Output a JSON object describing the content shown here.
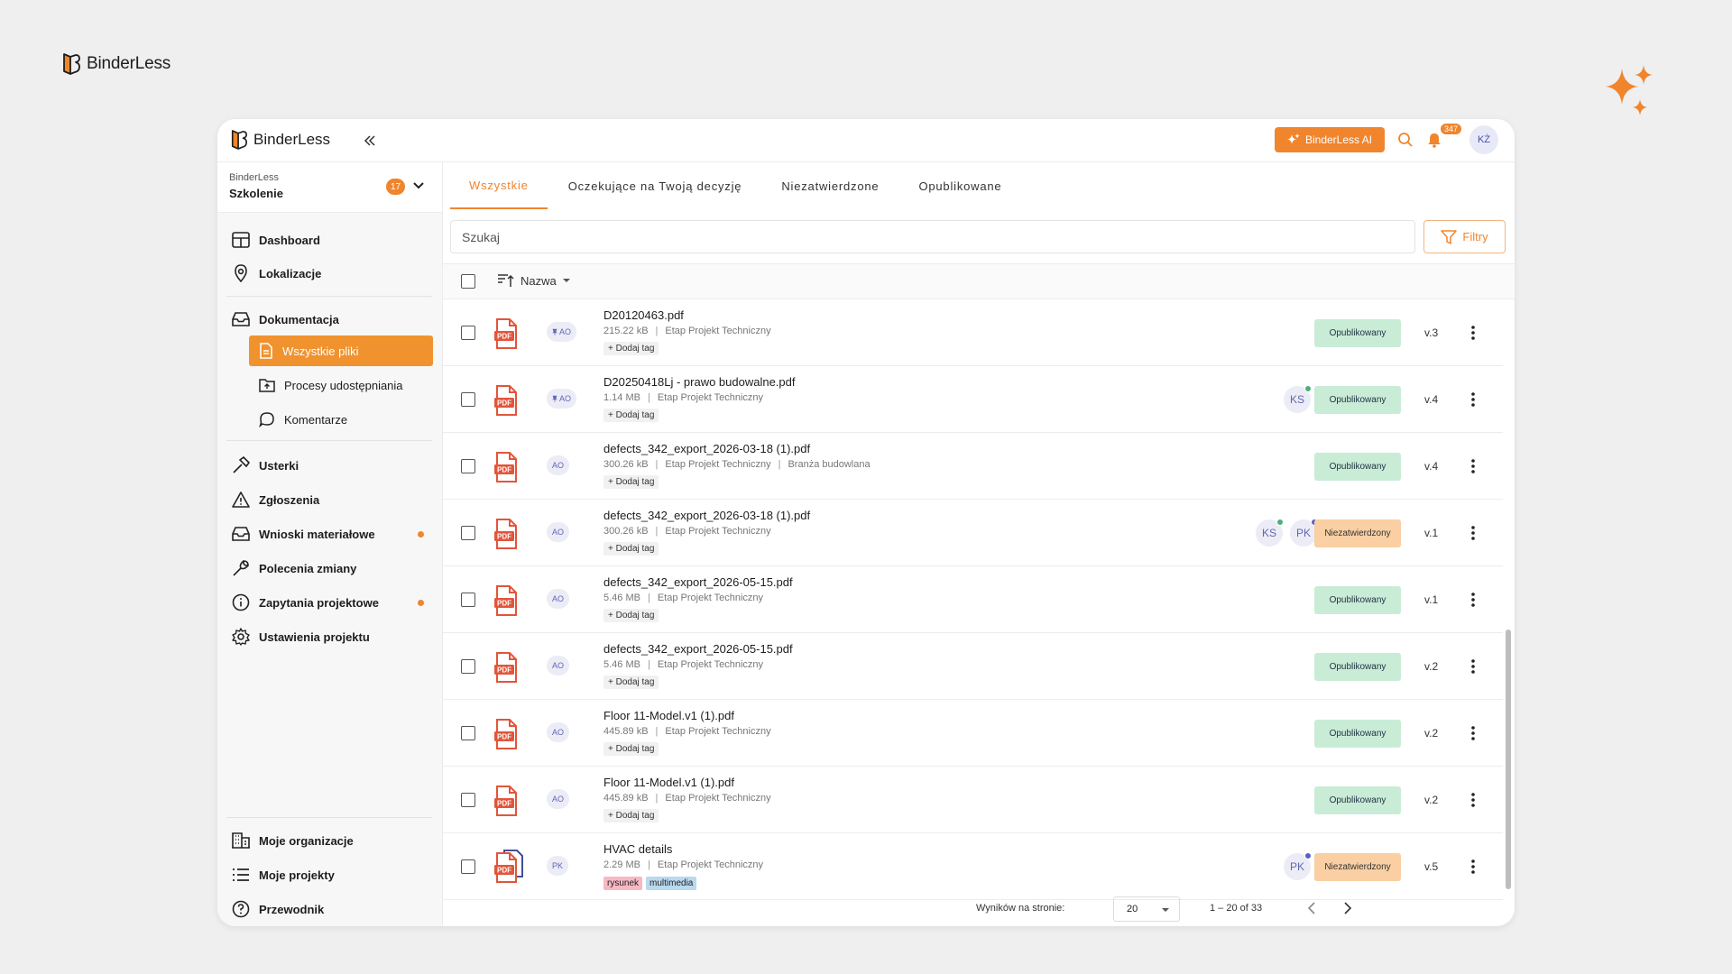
{
  "brand": {
    "name": "BinderLess"
  },
  "topbar": {
    "ai_label": "BinderLess AI",
    "notifications": "347",
    "user_initials": "KŻ"
  },
  "org": {
    "sub": "BinderLess",
    "name": "Szkolenie",
    "badge": "17"
  },
  "nav": {
    "dashboard": "Dashboard",
    "lokalizacje": "Lokalizacje",
    "dokumentacja": "Dokumentacja",
    "wszystkie_pliki": "Wszystkie pliki",
    "procesy": "Procesy udostępniania",
    "komentarze": "Komentarze",
    "usterki": "Usterki",
    "zgloszenia": "Zgłoszenia",
    "wnioski": "Wnioski materiałowe",
    "polecenia": "Polecenia zmiany",
    "zapytania": "Zapytania projektowe",
    "ustawienia": "Ustawienia projektu",
    "organizacje": "Moje organizacje",
    "projekty": "Moje projekty",
    "przewodnik": "Przewodnik"
  },
  "tabs": [
    "Wszystkie",
    "Oczekujące na Twoją decyzję",
    "Niezatwierdzone",
    "Opublikowane"
  ],
  "search": {
    "placeholder": "Szukaj"
  },
  "filters_label": "Filtry",
  "sort_label": "Nazwa",
  "status_labels": {
    "pub": "Opublikowany",
    "unc": "Niezatwierdzony"
  },
  "add_tag": "+ Dodaj tag",
  "rows": [
    {
      "name": "D20120463.pdf",
      "size": "215.22 kB",
      "stage": "Etap Projekt Techniczny",
      "extra": "",
      "owner": "AO",
      "version": "v.3",
      "status": "Opublikowany"
    },
    {
      "name": "D20250418Lj - prawo budowalne.pdf",
      "size": "1.14 MB",
      "stage": "Etap Projekt Techniczny",
      "extra": "",
      "owner": "AO",
      "version": "v.4",
      "status": "Opublikowany",
      "approvers": [
        "KS"
      ]
    },
    {
      "name": "defects_342_export_2026-03-18 (1).pdf",
      "size": "300.26 kB",
      "stage": "Etap Projekt Techniczny",
      "extra": "Branża budowlana",
      "owner": "AO",
      "version": "v.4",
      "status": "Opublikowany"
    },
    {
      "name": "defects_342_export_2026-03-18 (1).pdf",
      "size": "300.26 kB",
      "stage": "Etap Projekt Techniczny",
      "extra": "",
      "owner": "AO",
      "version": "v.1",
      "status": "Niezatwierdzony",
      "approvers": [
        "KS",
        "PK"
      ]
    },
    {
      "name": "defects_342_export_2026-05-15.pdf",
      "size": "5.46 MB",
      "stage": "Etap Projekt Techniczny",
      "extra": "",
      "owner": "AO",
      "version": "v.1",
      "status": "Opublikowany"
    },
    {
      "name": "defects_342_export_2026-05-15.pdf",
      "size": "5.46 MB",
      "stage": "Etap Projekt Techniczny",
      "extra": "",
      "owner": "AO",
      "version": "v.2",
      "status": "Opublikowany"
    },
    {
      "name": "Floor 11-Model.v1 (1).pdf",
      "size": "445.89 kB",
      "stage": "Etap Projekt Techniczny",
      "extra": "",
      "owner": "AO",
      "version": "v.2",
      "status": "Opublikowany"
    },
    {
      "name": "Floor 11-Model.v1 (1).pdf",
      "size": "445.89 kB",
      "stage": "Etap Projekt Techniczny",
      "extra": "",
      "owner": "AO",
      "version": "v.2",
      "status": "Opublikowany"
    },
    {
      "name": "HVAC details",
      "size": "2.29 MB",
      "stage": "Etap Projekt Techniczny",
      "extra": "",
      "owner": "PK",
      "version": "v.5",
      "status": "Niezatwierdzony",
      "approvers": [
        "PK"
      ],
      "tags": [
        "rysunek",
        "multimedia"
      ]
    }
  ],
  "footer": {
    "per_page_label": "Wyników na stronie:",
    "per_page": "20",
    "range": "1 – 20 of 33"
  },
  "colors": {
    "accent": "#f0852d",
    "published": "#c9ecd7",
    "unconfirmed": "#f9cfa3"
  }
}
